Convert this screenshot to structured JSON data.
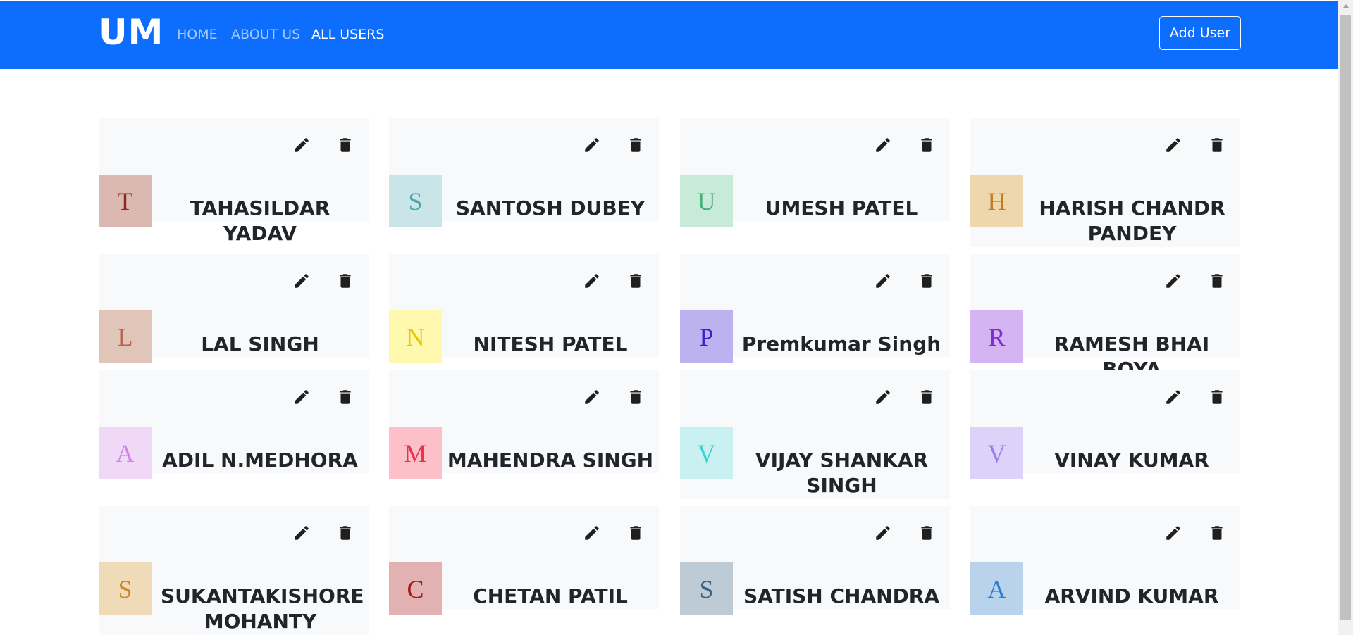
{
  "navbar": {
    "brand": "UM",
    "links": [
      "HOME",
      "ABOUT US",
      "ALL USERS"
    ],
    "active_link": "ALL USERS",
    "add_user_label": "Add User",
    "color": "#0d6efd"
  },
  "users": [
    {
      "initial": "T",
      "name": "TAHASILDAR YADAV",
      "bg": "#dcb8b2",
      "fg": "#8b2a1a"
    },
    {
      "initial": "S",
      "name": "SANTOSH DUBEY",
      "bg": "#c9e5e8",
      "fg": "#4aa5ad"
    },
    {
      "initial": "U",
      "name": "UMESH PATEL",
      "bg": "#c8ead9",
      "fg": "#45b27a"
    },
    {
      "initial": "H",
      "name": "HARISH CHANDR PANDEY",
      "bg": "#efd7ad",
      "fg": "#c27c1e"
    },
    {
      "initial": "L",
      "name": "LAL SINGH",
      "bg": "#e2c5b9",
      "fg": "#b6654a"
    },
    {
      "initial": "N",
      "name": "NITESH PATEL",
      "bg": "#fff9b0",
      "fg": "#e6c800"
    },
    {
      "initial": "P",
      "name": "Premkumar Singh",
      "bg": "#bdb2f0",
      "fg": "#3a22c8"
    },
    {
      "initial": "R",
      "name": "RAMESH BHAI BOYA",
      "bg": "#d4b4f2",
      "fg": "#7d2dd0"
    },
    {
      "initial": "A",
      "name": "ADIL N.MEDHORA",
      "bg": "#f0d8f7",
      "fg": "#d184e8"
    },
    {
      "initial": "M",
      "name": "MAHENDRA SINGH",
      "bg": "#fdc0c9",
      "fg": "#ee2f4d"
    },
    {
      "initial": "V",
      "name": "VIJAY SHANKAR SINGH",
      "bg": "#caf1f1",
      "fg": "#3dd0cf"
    },
    {
      "initial": "V",
      "name": "VINAY KUMAR",
      "bg": "#ddd2f9",
      "fg": "#9c7fe8"
    },
    {
      "initial": "S",
      "name": "SUKANTAKISHORE MOHANTY",
      "bg": "#efdbb7",
      "fg": "#c98a2e"
    },
    {
      "initial": "C",
      "name": "CHETAN PATIL",
      "bg": "#e2b2b2",
      "fg": "#a71b1b"
    },
    {
      "initial": "S",
      "name": "SATISH CHANDRA",
      "bg": "#bccbd6",
      "fg": "#3c6282"
    },
    {
      "initial": "A",
      "name": "ARVIND KUMAR",
      "bg": "#b9d3ed",
      "fg": "#2f7dcc"
    }
  ],
  "icons": {
    "edit": "pencil-icon",
    "delete": "trash-icon"
  }
}
